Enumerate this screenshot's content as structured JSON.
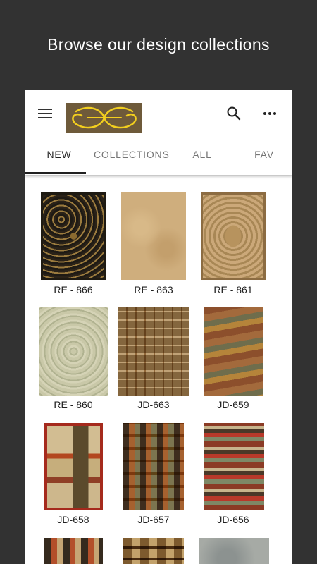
{
  "headline": "Browse our design collections",
  "app": {
    "logo_icon": "ornamental-swirl-logo",
    "colors": {
      "logo_bg": "#6e5a3a",
      "logo_stroke": "#f3cf1e",
      "active_tab": "#212121",
      "inactive_tab": "#757575"
    },
    "toolbar": {
      "menu_icon": "hamburger-menu-icon",
      "search_icon": "search-icon",
      "more_icon": "more-horizontal-icon"
    },
    "tabs": [
      {
        "label": "NEW",
        "active": true
      },
      {
        "label": "COLLECTIONS",
        "active": false
      },
      {
        "label": "ALL",
        "active": false
      },
      {
        "label": "FAV",
        "active": false
      }
    ]
  },
  "designs": [
    {
      "code": "RE - 866"
    },
    {
      "code": "RE - 863"
    },
    {
      "code": "RE - 861"
    },
    {
      "code": "RE - 860"
    },
    {
      "code": "JD-663"
    },
    {
      "code": "JD-659"
    },
    {
      "code": "JD-658"
    },
    {
      "code": "JD-657"
    },
    {
      "code": "JD-656"
    },
    {
      "code": ""
    },
    {
      "code": ""
    },
    {
      "code": ""
    }
  ]
}
